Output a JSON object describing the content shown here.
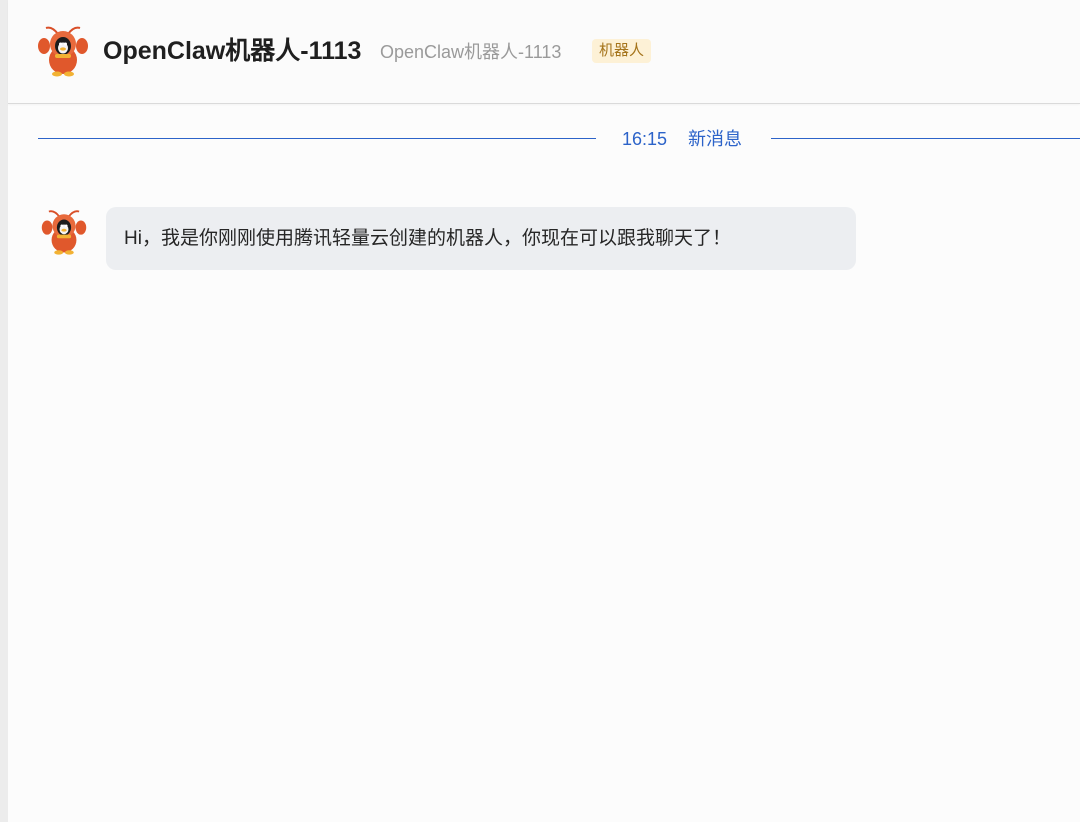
{
  "header": {
    "title": "OpenClaw机器人-1113",
    "subtitle": "OpenClaw机器人-1113",
    "badge": "机器人",
    "avatar_icon": "lobster-mascot-icon"
  },
  "divider": {
    "time": "16:15",
    "label": "新消息"
  },
  "messages": [
    {
      "avatar_icon": "lobster-mascot-icon",
      "text": "Hi，我是你刚刚使用腾讯轻量云创建的机器人，你现在可以跟我聊天了！"
    }
  ],
  "colors": {
    "accent": "#2c63c9",
    "badge_bg": "#fdf1d6",
    "badge_text": "#a5741b",
    "bubble_bg": "#eceef1",
    "mascot": "#e0582c"
  }
}
